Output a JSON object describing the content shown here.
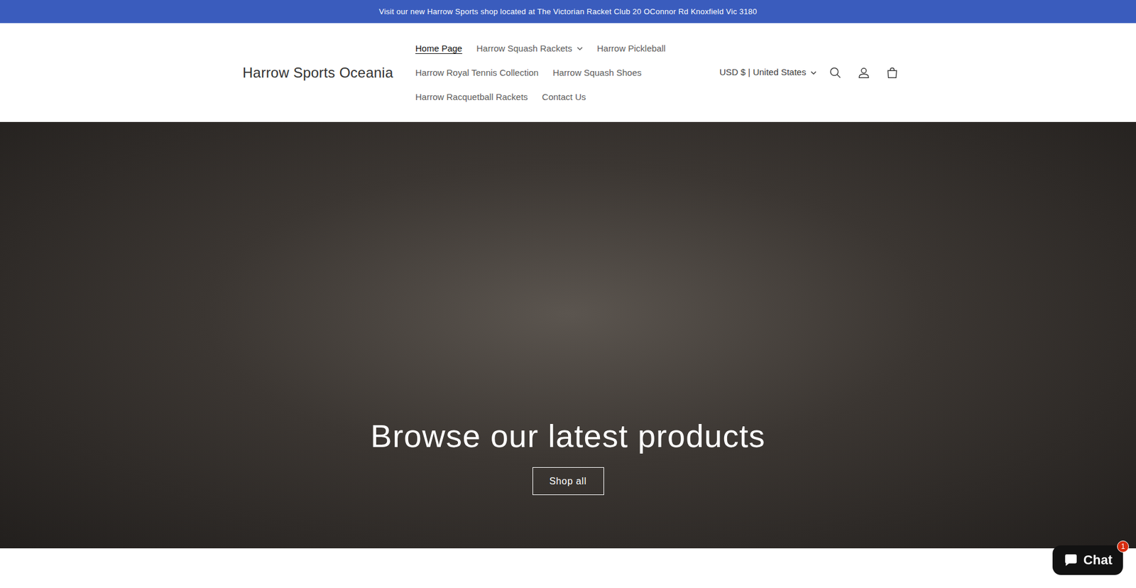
{
  "announcement": "Visit our new Harrow Sports shop located at The Victorian Racket Club 20 OConnor Rd Knoxfield Vic 3180",
  "logo": "Harrow Sports Oceania",
  "nav": [
    {
      "label": "Home Page",
      "selected": true,
      "kind": "link"
    },
    {
      "label": "Harrow Squash Rackets",
      "selected": false,
      "kind": "dropdown"
    },
    {
      "label": "Harrow Pickleball",
      "selected": false,
      "kind": "link"
    },
    {
      "label": "Harrow Royal Tennis Collection",
      "selected": false,
      "kind": "link"
    },
    {
      "label": "Harrow Squash Shoes",
      "selected": false,
      "kind": "link"
    },
    {
      "label": "Harrow Racquetball Rackets",
      "selected": false,
      "kind": "link"
    },
    {
      "label": "Contact Us",
      "selected": false,
      "kind": "link"
    }
  ],
  "currency": {
    "label": "USD $ | United States"
  },
  "hero": {
    "heading": "Browse our latest products",
    "button": "Shop all"
  },
  "chat": {
    "label": "Chat",
    "badge": "1"
  }
}
